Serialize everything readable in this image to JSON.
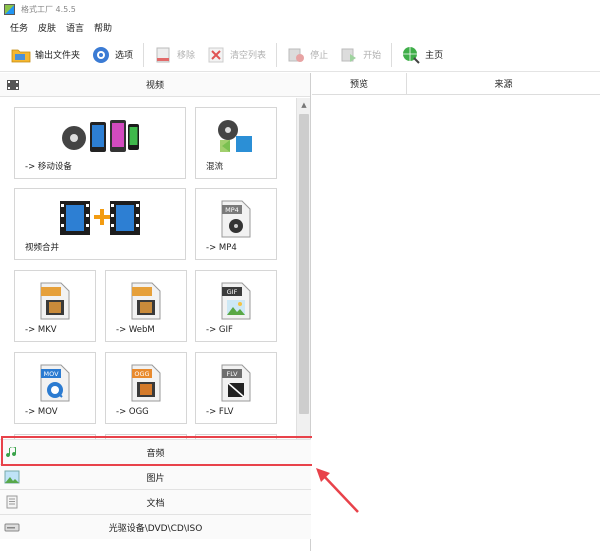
{
  "window": {
    "title": "格式工厂 4.5.5"
  },
  "menu": [
    "任务",
    "皮肤",
    "语言",
    "帮助"
  ],
  "toolbar": {
    "output_folder": "输出文件夹",
    "options": "选项",
    "remove": "移除",
    "clear_list": "清空列表",
    "stop": "停止",
    "start": "开始",
    "home": "主页"
  },
  "left": {
    "video_header": "视频",
    "tiles": [
      {
        "label": "-> 移动设备",
        "icon": "mobile-devices-icon"
      },
      {
        "label": "混流",
        "icon": "mux-icon"
      },
      {
        "label": "视频合并",
        "icon": "video-join-icon"
      },
      {
        "label": "-> MP4",
        "icon": "mp4-file-icon",
        "badge": "MP4"
      },
      {
        "label": "-> MKV",
        "icon": "mkv-file-icon"
      },
      {
        "label": "-> WebM",
        "icon": "webm-file-icon"
      },
      {
        "label": "-> GIF",
        "icon": "gif-file-icon",
        "badge": "GIF"
      },
      {
        "label": "-> MOV",
        "icon": "mov-file-icon",
        "badge": "MOV"
      },
      {
        "label": "-> OGG",
        "icon": "ogg-file-icon",
        "badge": "OGG"
      },
      {
        "label": "-> FLV",
        "icon": "flv-file-icon",
        "badge": "FLV"
      }
    ],
    "categories": [
      {
        "label": "音频",
        "icon": "music-note-icon"
      },
      {
        "label": "图片",
        "icon": "picture-icon"
      },
      {
        "label": "文档",
        "icon": "document-icon"
      },
      {
        "label": "光驱设备\\DVD\\CD\\ISO",
        "icon": "disc-drive-icon"
      }
    ]
  },
  "right": {
    "columns": [
      "预览",
      "来源"
    ]
  },
  "colors": {
    "highlight": "#e8424a",
    "arrow": "#e8424a"
  }
}
